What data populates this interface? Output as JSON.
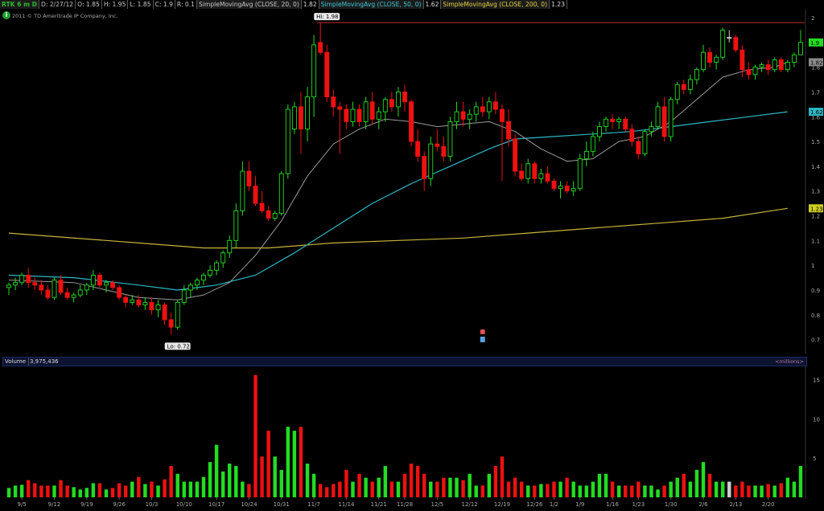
{
  "header": {
    "symbol": "RTK 6 m D",
    "date": "D: 2/27/12",
    "open": "O: 1.85",
    "high": "H: 1.95",
    "low": "L: 1.85",
    "close": "C: 1.9",
    "range": "R: 0.1",
    "sma20_label": "SimpleMovingAvg (CLOSE, 20, 0)",
    "sma20_value": "1.82",
    "sma50_label": "SimpleMovingAvg (CLOSE, 50, 0)",
    "sma50_value": "1.62",
    "sma200_label": "SimpleMovingAvg (CLOSE, 200, 0)",
    "sma200_value": "1.23"
  },
  "copyright": "2011 © TD Ameritrade IP Company, Inc.",
  "info_icon": "i",
  "volume_panel": {
    "label": "Volume",
    "value": "3,975,436",
    "units": "<millions>"
  },
  "colors": {
    "up": "#22dd22",
    "down": "#ee1111",
    "neutral": "#cccccc",
    "sma20": "#9a9a9a",
    "sma50": "#2bb8c4",
    "sma200": "#c8b43a",
    "hi_line": "#c03030",
    "background": "#000000"
  },
  "chart_data": [
    {
      "type": "candlestick",
      "title": "",
      "ylim": [
        0.65,
        2.0
      ],
      "y_ticks": [
        "0.7",
        "0.8",
        "0.9",
        "1",
        "1.1",
        "1.2",
        "1.3",
        "1.4",
        "1.5",
        "1.6",
        "1.7",
        "1.8",
        "1.9",
        "2"
      ],
      "x_ticks": [
        {
          "label": "9/5",
          "index": 2
        },
        {
          "label": "9/12",
          "index": 7
        },
        {
          "label": "9/19",
          "index": 12
        },
        {
          "label": "9/26",
          "index": 17
        },
        {
          "label": "10/3",
          "index": 22
        },
        {
          "label": "10/10",
          "index": 27
        },
        {
          "label": "10/17",
          "index": 32
        },
        {
          "label": "10/24",
          "index": 37
        },
        {
          "label": "10/31",
          "index": 42
        },
        {
          "label": "11/7",
          "index": 47
        },
        {
          "label": "11/14",
          "index": 52
        },
        {
          "label": "11/21",
          "index": 57
        },
        {
          "label": "11/28",
          "index": 61
        },
        {
          "label": "12/5",
          "index": 66
        },
        {
          "label": "12/12",
          "index": 71
        },
        {
          "label": "12/19",
          "index": 76
        },
        {
          "label": "12/26",
          "index": 81
        },
        {
          "label": "1/2",
          "index": 84
        },
        {
          "label": "1/9",
          "index": 88
        },
        {
          "label": "1/16",
          "index": 93
        },
        {
          "label": "1/23",
          "index": 97
        },
        {
          "label": "1/30",
          "index": 102
        },
        {
          "label": "2/6",
          "index": 107
        },
        {
          "label": "2/13",
          "index": 112
        },
        {
          "label": "2/20",
          "index": 117
        }
      ],
      "ohlc": [
        [
          0.91,
          0.93,
          0.88,
          0.92
        ],
        [
          0.92,
          0.95,
          0.9,
          0.93
        ],
        [
          0.93,
          0.97,
          0.92,
          0.96
        ],
        [
          0.96,
          0.99,
          0.91,
          0.93
        ],
        [
          0.93,
          0.95,
          0.9,
          0.92
        ],
        [
          0.92,
          0.94,
          0.88,
          0.9
        ],
        [
          0.9,
          0.92,
          0.86,
          0.87
        ],
        [
          0.87,
          0.95,
          0.86,
          0.94
        ],
        [
          0.94,
          0.96,
          0.88,
          0.89
        ],
        [
          0.89,
          0.91,
          0.86,
          0.87
        ],
        [
          0.87,
          0.89,
          0.85,
          0.88
        ],
        [
          0.88,
          0.92,
          0.87,
          0.9
        ],
        [
          0.9,
          0.93,
          0.88,
          0.92
        ],
        [
          0.92,
          0.98,
          0.9,
          0.96
        ],
        [
          0.96,
          0.97,
          0.91,
          0.92
        ],
        [
          0.92,
          0.94,
          0.89,
          0.93
        ],
        [
          0.93,
          0.94,
          0.9,
          0.91
        ],
        [
          0.91,
          0.92,
          0.86,
          0.87
        ],
        [
          0.87,
          0.88,
          0.83,
          0.85
        ],
        [
          0.85,
          0.88,
          0.84,
          0.86
        ],
        [
          0.86,
          0.88,
          0.83,
          0.84
        ],
        [
          0.84,
          0.87,
          0.82,
          0.85
        ],
        [
          0.85,
          0.87,
          0.8,
          0.82
        ],
        [
          0.82,
          0.86,
          0.79,
          0.84
        ],
        [
          0.84,
          0.85,
          0.76,
          0.78
        ],
        [
          0.78,
          0.81,
          0.72,
          0.75
        ],
        [
          0.75,
          0.86,
          0.74,
          0.85
        ],
        [
          0.85,
          0.92,
          0.84,
          0.9
        ],
        [
          0.9,
          0.93,
          0.87,
          0.92
        ],
        [
          0.92,
          0.95,
          0.9,
          0.94
        ],
        [
          0.94,
          0.97,
          0.92,
          0.96
        ],
        [
          0.96,
          1.0,
          0.95,
          0.98
        ],
        [
          0.98,
          1.02,
          0.96,
          1.01
        ],
        [
          1.01,
          1.06,
          0.99,
          1.05
        ],
        [
          1.05,
          1.12,
          1.03,
          1.1
        ],
        [
          1.1,
          1.25,
          1.07,
          1.22
        ],
        [
          1.22,
          1.42,
          1.2,
          1.38
        ],
        [
          1.38,
          1.42,
          1.3,
          1.32
        ],
        [
          1.32,
          1.36,
          1.24,
          1.25
        ],
        [
          1.25,
          1.3,
          1.21,
          1.22
        ],
        [
          1.22,
          1.24,
          1.18,
          1.19
        ],
        [
          1.19,
          1.22,
          1.18,
          1.21
        ],
        [
          1.21,
          1.38,
          1.2,
          1.37
        ],
        [
          1.37,
          1.65,
          1.35,
          1.63
        ],
        [
          1.55,
          1.66,
          1.53,
          1.64
        ],
        [
          1.64,
          1.7,
          1.45,
          1.55
        ],
        [
          1.55,
          1.72,
          1.5,
          1.68
        ],
        [
          1.68,
          1.93,
          1.6,
          1.89
        ],
        [
          1.9,
          1.98,
          1.85,
          1.86
        ],
        [
          1.86,
          1.89,
          1.66,
          1.68
        ],
        [
          1.68,
          1.71,
          1.6,
          1.64
        ],
        [
          1.64,
          1.66,
          1.45,
          1.63
        ],
        [
          1.63,
          1.65,
          1.55,
          1.58
        ],
        [
          1.58,
          1.66,
          1.56,
          1.63
        ],
        [
          1.63,
          1.65,
          1.56,
          1.58
        ],
        [
          1.58,
          1.68,
          1.55,
          1.66
        ],
        [
          1.66,
          1.7,
          1.57,
          1.59
        ],
        [
          1.59,
          1.64,
          1.55,
          1.62
        ],
        [
          1.62,
          1.68,
          1.58,
          1.67
        ],
        [
          1.67,
          1.7,
          1.62,
          1.64
        ],
        [
          1.64,
          1.72,
          1.6,
          1.7
        ],
        [
          1.7,
          1.73,
          1.62,
          1.66
        ],
        [
          1.66,
          1.67,
          1.48,
          1.5
        ],
        [
          1.5,
          1.55,
          1.42,
          1.44
        ],
        [
          1.44,
          1.46,
          1.3,
          1.35
        ],
        [
          1.35,
          1.52,
          1.32,
          1.49
        ],
        [
          1.49,
          1.55,
          1.46,
          1.48
        ],
        [
          1.48,
          1.52,
          1.42,
          1.44
        ],
        [
          1.44,
          1.6,
          1.42,
          1.58
        ],
        [
          1.58,
          1.66,
          1.55,
          1.62
        ],
        [
          1.62,
          1.66,
          1.56,
          1.59
        ],
        [
          1.59,
          1.63,
          1.55,
          1.61
        ],
        [
          1.61,
          1.66,
          1.58,
          1.64
        ],
        [
          1.64,
          1.68,
          1.6,
          1.62
        ],
        [
          1.62,
          1.68,
          1.59,
          1.66
        ],
        [
          1.66,
          1.7,
          1.61,
          1.63
        ],
        [
          1.63,
          1.65,
          1.34,
          1.58
        ],
        [
          1.58,
          1.63,
          1.48,
          1.51
        ],
        [
          1.51,
          1.53,
          1.36,
          1.38
        ],
        [
          1.38,
          1.41,
          1.34,
          1.35
        ],
        [
          1.35,
          1.43,
          1.33,
          1.41
        ],
        [
          1.41,
          1.42,
          1.33,
          1.35
        ],
        [
          1.35,
          1.39,
          1.33,
          1.37
        ],
        [
          1.37,
          1.4,
          1.33,
          1.34
        ],
        [
          1.34,
          1.35,
          1.3,
          1.31
        ],
        [
          1.31,
          1.34,
          1.27,
          1.32
        ],
        [
          1.32,
          1.34,
          1.29,
          1.3
        ],
        [
          1.3,
          1.34,
          1.28,
          1.31
        ],
        [
          1.31,
          1.45,
          1.3,
          1.43
        ],
        [
          1.43,
          1.5,
          1.4,
          1.46
        ],
        [
          1.46,
          1.54,
          1.44,
          1.52
        ],
        [
          1.52,
          1.58,
          1.5,
          1.56
        ],
        [
          1.56,
          1.6,
          1.54,
          1.59
        ],
        [
          1.59,
          1.61,
          1.55,
          1.58
        ],
        [
          1.58,
          1.6,
          1.55,
          1.59
        ],
        [
          1.59,
          1.6,
          1.54,
          1.55
        ],
        [
          1.55,
          1.57,
          1.48,
          1.5
        ],
        [
          1.5,
          1.52,
          1.43,
          1.45
        ],
        [
          1.45,
          1.55,
          1.44,
          1.54
        ],
        [
          1.54,
          1.58,
          1.52,
          1.56
        ],
        [
          1.56,
          1.66,
          1.55,
          1.64
        ],
        [
          1.64,
          1.68,
          1.5,
          1.52
        ],
        [
          1.52,
          1.68,
          1.5,
          1.67
        ],
        [
          1.67,
          1.74,
          1.65,
          1.73
        ],
        [
          1.73,
          1.75,
          1.69,
          1.71
        ],
        [
          1.71,
          1.77,
          1.69,
          1.75
        ],
        [
          1.75,
          1.8,
          1.73,
          1.79
        ],
        [
          1.79,
          1.89,
          1.78,
          1.86
        ],
        [
          1.86,
          1.88,
          1.8,
          1.82
        ],
        [
          1.82,
          1.85,
          1.79,
          1.84
        ],
        [
          1.84,
          1.96,
          1.83,
          1.95
        ],
        [
          1.92,
          1.95,
          1.9,
          1.92
        ],
        [
          1.92,
          1.93,
          1.86,
          1.87
        ],
        [
          1.87,
          1.89,
          1.76,
          1.79
        ],
        [
          1.79,
          1.82,
          1.75,
          1.77
        ],
        [
          1.77,
          1.81,
          1.75,
          1.8
        ],
        [
          1.8,
          1.82,
          1.78,
          1.81
        ],
        [
          1.81,
          1.83,
          1.77,
          1.79
        ],
        [
          1.79,
          1.84,
          1.78,
          1.83
        ],
        [
          1.83,
          1.84,
          1.78,
          1.79
        ],
        [
          1.79,
          1.83,
          1.78,
          1.82
        ],
        [
          1.82,
          1.86,
          1.8,
          1.85
        ],
        [
          1.85,
          1.95,
          1.85,
          1.9
        ]
      ],
      "sma20_samples": [
        [
          0,
          0.94
        ],
        [
          10,
          0.93
        ],
        [
          20,
          0.87
        ],
        [
          26,
          0.86
        ],
        [
          30,
          0.88
        ],
        [
          34,
          0.93
        ],
        [
          38,
          1.04
        ],
        [
          42,
          1.18
        ],
        [
          46,
          1.36
        ],
        [
          50,
          1.49
        ],
        [
          54,
          1.55
        ],
        [
          58,
          1.59
        ],
        [
          62,
          1.58
        ],
        [
          66,
          1.56
        ],
        [
          70,
          1.57
        ],
        [
          74,
          1.58
        ],
        [
          78,
          1.54
        ],
        [
          82,
          1.47
        ],
        [
          86,
          1.42
        ],
        [
          90,
          1.43
        ],
        [
          94,
          1.5
        ],
        [
          98,
          1.52
        ],
        [
          102,
          1.58
        ],
        [
          106,
          1.67
        ],
        [
          110,
          1.76
        ],
        [
          114,
          1.79
        ],
        [
          118,
          1.8
        ],
        [
          120,
          1.82
        ]
      ],
      "sma50_samples": [
        [
          0,
          0.96
        ],
        [
          10,
          0.95
        ],
        [
          20,
          0.92
        ],
        [
          26,
          0.9
        ],
        [
          32,
          0.92
        ],
        [
          38,
          0.96
        ],
        [
          44,
          1.05
        ],
        [
          50,
          1.15
        ],
        [
          56,
          1.25
        ],
        [
          62,
          1.33
        ],
        [
          68,
          1.4
        ],
        [
          74,
          1.47
        ],
        [
          78,
          1.51
        ],
        [
          84,
          1.52
        ],
        [
          90,
          1.53
        ],
        [
          96,
          1.54
        ],
        [
          102,
          1.56
        ],
        [
          108,
          1.58
        ],
        [
          114,
          1.6
        ],
        [
          120,
          1.62
        ]
      ],
      "sma200_samples": [
        [
          0,
          1.13
        ],
        [
          20,
          1.09
        ],
        [
          30,
          1.07
        ],
        [
          40,
          1.07
        ],
        [
          50,
          1.09
        ],
        [
          60,
          1.1
        ],
        [
          70,
          1.11
        ],
        [
          80,
          1.13
        ],
        [
          90,
          1.15
        ],
        [
          100,
          1.17
        ],
        [
          110,
          1.19
        ],
        [
          120,
          1.23
        ]
      ],
      "annotations": [
        {
          "text": "Hi: 1.98",
          "index": 48,
          "value": 1.98
        },
        {
          "text": "Lo: 0.72",
          "index": 25,
          "value": 0.72
        }
      ],
      "price_labels": [
        {
          "text": "1.9",
          "value": 1.9,
          "series": "close"
        },
        {
          "text": "1.82",
          "value": 1.82,
          "series": "sma20"
        },
        {
          "text": "1.62",
          "value": 1.62,
          "series": "sma50"
        },
        {
          "text": "1.23",
          "value": 1.23,
          "series": "sma200"
        }
      ]
    },
    {
      "type": "bar",
      "title": "",
      "ylabel": "",
      "ylim": [
        0,
        16.5
      ],
      "y_ticks": [
        "5",
        "10",
        "15"
      ],
      "values": [
        1.2,
        1.5,
        1.6,
        2.2,
        1.8,
        1.5,
        1.5,
        1.5,
        2.2,
        1.5,
        1.3,
        1.0,
        1.2,
        1.8,
        1.8,
        1.0,
        1.2,
        1.8,
        1.5,
        2.0,
        2.6,
        1.7,
        2.0,
        1.5,
        2.3,
        4.0,
        3.0,
        2.0,
        2.0,
        2.0,
        2.6,
        4.5,
        6.7,
        3.3,
        4.3,
        4.0,
        2.0,
        1.7,
        15.6,
        5.2,
        8.5,
        5.2,
        3.5,
        9.0,
        8.5,
        9.0,
        4.3,
        3.0,
        1.7,
        1.3,
        1.7,
        2.0,
        3.5,
        2.0,
        3.0,
        2.5,
        2.0,
        2.5,
        4.0,
        2.0,
        2.0,
        3.0,
        4.3,
        4.0,
        3.0,
        2.0,
        2.0,
        2.5,
        2.5,
        2.5,
        2.2,
        3.0,
        1.5,
        1.5,
        3.0,
        4.0,
        5.2,
        2.0,
        2.5,
        2.0,
        1.5,
        1.5,
        1.7,
        1.7,
        2.0,
        2.0,
        2.5,
        2.0,
        1.5,
        1.5,
        2.0,
        3.0,
        3.0,
        2.0,
        1.5,
        1.5,
        1.5,
        2.0,
        1.5,
        1.5,
        1.0,
        1.5,
        2.0,
        2.5,
        3.0,
        2.0,
        3.5,
        4.5,
        3.0,
        2.0,
        2.0,
        2.0,
        1.5,
        2.0,
        1.5,
        1.5,
        1.5,
        1.7,
        1.5,
        1.8,
        2.5,
        2.0,
        4.0
      ]
    }
  ]
}
